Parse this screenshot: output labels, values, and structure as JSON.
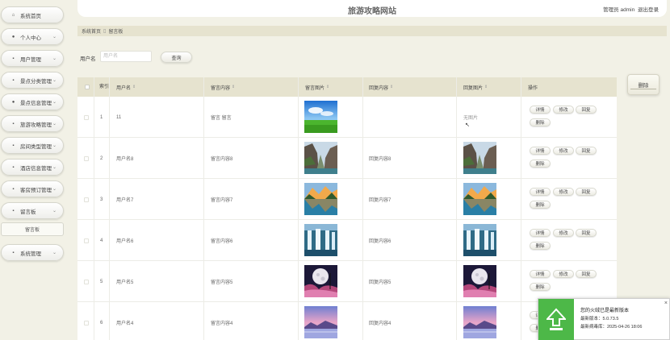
{
  "header": {
    "title": "旅游攻略网站",
    "user_label": "管理员 admin",
    "logout": "退出登录"
  },
  "sidebar": {
    "items": [
      {
        "label": "系统首页",
        "icon": "home-icon",
        "has_chevron": false
      },
      {
        "label": "个人中心",
        "icon": "user-icon",
        "has_chevron": true
      },
      {
        "label": "用户管理",
        "icon": "grid-icon",
        "has_chevron": true
      },
      {
        "label": "景点分类管理",
        "icon": "grid-icon",
        "has_chevron": true
      },
      {
        "label": "景点信息管理",
        "icon": "user-icon",
        "has_chevron": true
      },
      {
        "label": "旅游攻略管理",
        "icon": "grid-icon",
        "has_chevron": true
      },
      {
        "label": "房间类型管理",
        "icon": "grid-icon",
        "has_chevron": true
      },
      {
        "label": "酒店信息管理",
        "icon": "grid-icon",
        "has_chevron": true
      },
      {
        "label": "客房预订管理",
        "icon": "grid-icon",
        "has_chevron": true
      },
      {
        "label": "留言板",
        "icon": "grid-icon",
        "has_chevron": true
      },
      {
        "label": "系统管理",
        "icon": "grid-icon",
        "has_chevron": true
      }
    ],
    "sub_item": "留言板"
  },
  "breadcrumb": {
    "home": "系统首页",
    "current": "留言板"
  },
  "search": {
    "label": "用户名",
    "placeholder": "用户名",
    "button": "查询"
  },
  "delete_button": "删除",
  "table": {
    "headers": {
      "index": "索引",
      "username": "用户名",
      "content": "留言内容",
      "image": "留言图片",
      "reply": "回复内容",
      "reply_image": "回复图片",
      "actions": "操作"
    },
    "rows": [
      {
        "index": "1",
        "username": "11",
        "content": "留言 留言",
        "image": "grass",
        "reply": "",
        "reply_image": null,
        "reply_image_text": "无图片"
      },
      {
        "index": "2",
        "username": "用户名8",
        "content": "留言内容8",
        "image": "canyon",
        "reply": "回复内容8",
        "reply_image": "canyon"
      },
      {
        "index": "3",
        "username": "用户名7",
        "content": "留言内容7",
        "image": "lake",
        "reply": "回复内容7",
        "reply_image": "lake"
      },
      {
        "index": "4",
        "username": "用户名6",
        "content": "留言内容6",
        "image": "waterfall",
        "reply": "回复内容6",
        "reply_image": "waterfall"
      },
      {
        "index": "5",
        "username": "用户名5",
        "content": "留言内容5",
        "image": "moon",
        "reply": "回复内容5",
        "reply_image": "moon"
      },
      {
        "index": "6",
        "username": "用户名4",
        "content": "留言内容4",
        "image": "sunset",
        "reply": "回复内容4",
        "reply_image": "sunset"
      }
    ],
    "actions": {
      "detail": "详情",
      "edit": "修改",
      "reply": "回复",
      "delete": "删除"
    }
  },
  "notification": {
    "title": "您的火绒已是最新版本",
    "version_line": "最新版本：5.0.73.5",
    "update_line": "最新病毒库：2025-04-26 18:06",
    "icon": "arrow-up-icon",
    "close": "×"
  },
  "colors": {
    "header_bar": "#e6e3cf",
    "background": "#f2f1e6",
    "notify_green": "#4db848"
  }
}
